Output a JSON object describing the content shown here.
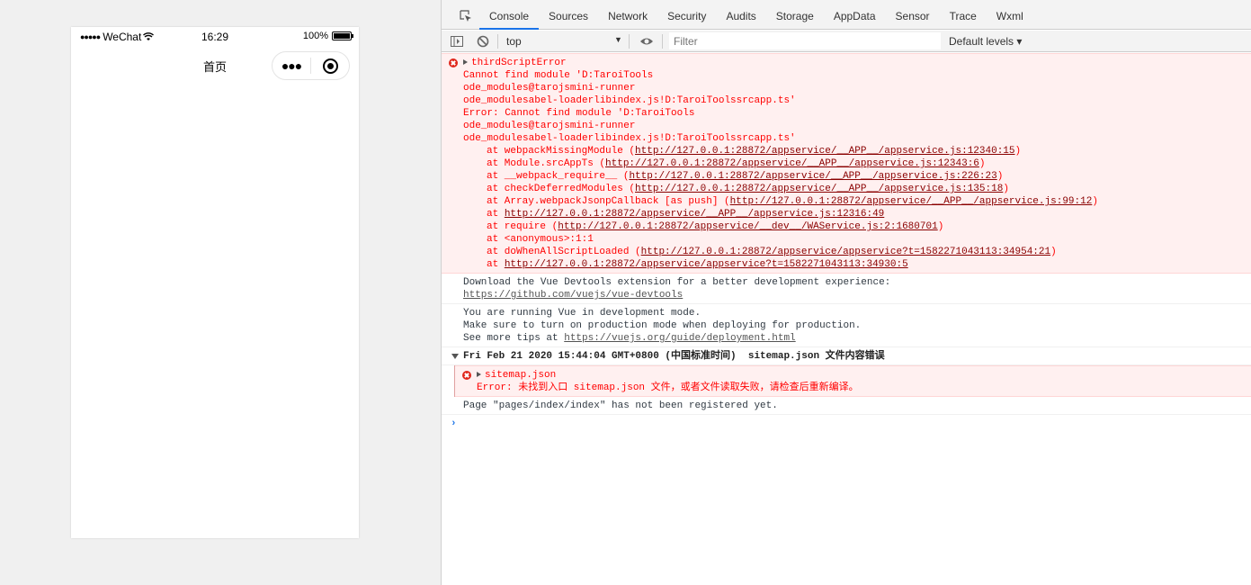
{
  "phone": {
    "status_signal": "●●●●●",
    "status_carrier": "WeChat",
    "status_time": "16:29",
    "status_battery": "100%",
    "page_title": "首页",
    "more_glyph": "●●●",
    "battery_level": 1.0
  },
  "devtools": {
    "tabs": [
      "Console",
      "Sources",
      "Network",
      "Security",
      "Audits",
      "Storage",
      "AppData",
      "Sensor",
      "Trace",
      "Wxml"
    ],
    "active_tab": "Console",
    "toolbar": {
      "context": "top",
      "filter_placeholder": "Filter",
      "levels": "Default levels ▾"
    }
  },
  "console": {
    "error1": {
      "title": "thirdScriptError",
      "lines": [
        "Cannot find module 'D:TaroiTools",
        "ode_modules@tarojsmini-runner",
        "ode_modulesabel-loaderlibindex.js!D:TaroiToolssrcapp.ts'",
        "Error: Cannot find module 'D:TaroiTools",
        "ode_modules@tarojsmini-runner",
        "ode_modulesabel-loaderlibindex.js!D:TaroiToolssrcapp.ts'"
      ],
      "stack": [
        {
          "pre": "at webpackMissingModule (",
          "link": "http://127.0.0.1:28872/appservice/__APP__/appservice.js:12340:15",
          "post": ")"
        },
        {
          "pre": "at Module.srcAppTs (",
          "link": "http://127.0.0.1:28872/appservice/__APP__/appservice.js:12343:6",
          "post": ")"
        },
        {
          "pre": "at __webpack_require__ (",
          "link": "http://127.0.0.1:28872/appservice/__APP__/appservice.js:226:23",
          "post": ")"
        },
        {
          "pre": "at checkDeferredModules (",
          "link": "http://127.0.0.1:28872/appservice/__APP__/appservice.js:135:18",
          "post": ")"
        },
        {
          "pre": "at Array.webpackJsonpCallback [as push] (",
          "link": "http://127.0.0.1:28872/appservice/__APP__/appservice.js:99:12",
          "post": ")"
        },
        {
          "pre": "at ",
          "link": "http://127.0.0.1:28872/appservice/__APP__/appservice.js:12316:49",
          "post": ""
        },
        {
          "pre": "at require (",
          "link": "http://127.0.0.1:28872/appservice/__dev__/WAService.js:2:1680701",
          "post": ")"
        },
        {
          "pre": "at <anonymous>:1:1",
          "link": "",
          "post": ""
        },
        {
          "pre": "at doWhenAllScriptLoaded (",
          "link": "http://127.0.0.1:28872/appservice/appservice?t=1582271043113:34954:21",
          "post": ")"
        },
        {
          "pre": "at ",
          "link": "http://127.0.0.1:28872/appservice/appservice?t=1582271043113:34930:5",
          "post": ""
        }
      ]
    },
    "vue_devtools": {
      "text": "Download the Vue Devtools extension for a better development experience:",
      "link": "https://github.com/vuejs/vue-devtools"
    },
    "vue_mode": {
      "line1": "You are running Vue in development mode.",
      "line2": "Make sure to turn on production mode when deploying for production.",
      "line3_pre": "See more tips at ",
      "line3_link": "https://vuejs.org/guide/deployment.html"
    },
    "group": {
      "title": "Fri Feb 21 2020 15:44:04 GMT+0800 (中国标准时间)  sitemap.json 文件内容错误",
      "error_title": "sitemap.json",
      "error_text": "Error: 未找到入口 sitemap.json 文件，或者文件读取失败，请检查后重新编译。"
    },
    "page_warning": "Page \"pages/index/index\" has not been registered yet.",
    "prompt": "›"
  }
}
